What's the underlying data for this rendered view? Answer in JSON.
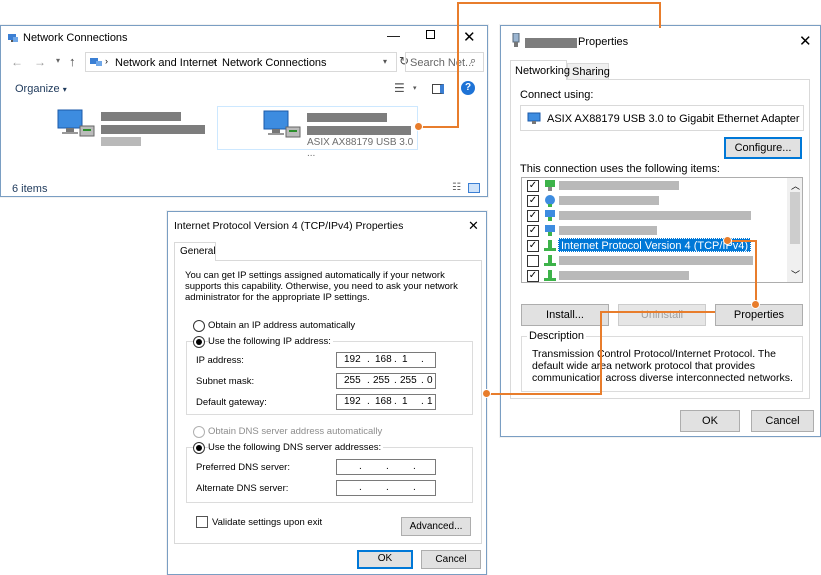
{
  "network_connections": {
    "title": "Network Connections",
    "breadcrumb": [
      "Network and Internet",
      "Network Connections"
    ],
    "search_placeholder": "Search Net...",
    "organize_label": "Organize",
    "adapter_description": "ASIX AX88179 USB 3.0 ...",
    "status_count": "6 items",
    "icons": [
      "back-arrow-icon",
      "forward-arrow-icon",
      "up-arrow-icon",
      "refresh-icon",
      "search-icon",
      "help-icon"
    ]
  },
  "properties": {
    "title": "Properties",
    "tabs": [
      "Networking",
      "Sharing"
    ],
    "connect_using_label": "Connect using:",
    "adapter_name": "ASIX AX88179 USB 3.0 to Gigabit Ethernet Adapter",
    "configure_label": "Configure...",
    "items_label": "This connection uses the following items:",
    "selected_item": "Internet Protocol Version 4 (TCP/IPv4)",
    "install_label": "Install...",
    "uninstall_label": "Uninstall",
    "properties_label": "Properties",
    "description_title": "Description",
    "description_text": "Transmission Control Protocol/Internet Protocol. The default wide area network protocol that provides communication across diverse interconnected networks.",
    "ok_label": "OK",
    "cancel_label": "Cancel"
  },
  "ipv4": {
    "title": "Internet Protocol Version 4 (TCP/IPv4) Properties",
    "tab": "General",
    "intro": "You can get IP settings assigned automatically if your network supports this capability. Otherwise, you need to ask your network administrator for the appropriate IP settings.",
    "obtain_ip_auto": "Obtain an IP address automatically",
    "use_following_ip": "Use the following IP address:",
    "ip_address_label": "IP address:",
    "subnet_mask_label": "Subnet mask:",
    "default_gateway_label": "Default gateway:",
    "ip_address": [
      "192",
      "168",
      "1",
      ""
    ],
    "subnet_mask": [
      "255",
      "255",
      "255",
      "0"
    ],
    "default_gateway": [
      "192",
      "168",
      "1",
      "1"
    ],
    "obtain_dns_auto": "Obtain DNS server address automatically",
    "use_following_dns": "Use the following DNS server addresses:",
    "preferred_dns_label": "Preferred DNS server:",
    "alternate_dns_label": "Alternate DNS server:",
    "validate_label": "Validate settings upon exit",
    "advanced_label": "Advanced...",
    "ok_label": "OK",
    "cancel_label": "Cancel"
  },
  "colors": {
    "accent": "#0078d7",
    "callout": "#e87d2c",
    "selection": "#0078d7"
  }
}
